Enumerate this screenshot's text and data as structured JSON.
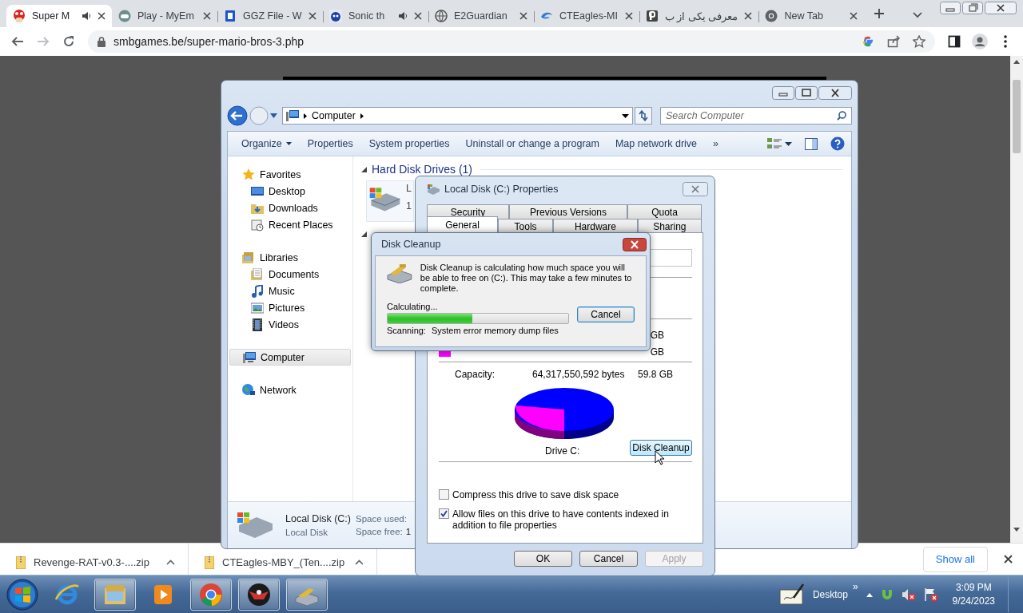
{
  "browser": {
    "tabs": [
      {
        "title": "Super M",
        "selected": true,
        "audio": true
      },
      {
        "title": "Play - MyEm",
        "selected": false,
        "audio": false
      },
      {
        "title": "GGZ File - W",
        "selected": false,
        "audio": false
      },
      {
        "title": "Sonic th",
        "selected": false,
        "audio": true
      },
      {
        "title": "E2Guardian",
        "selected": false,
        "audio": false
      },
      {
        "title": "CTEagles-MI",
        "selected": false,
        "audio": false
      },
      {
        "title": "معرفی یکی از ب",
        "selected": false,
        "audio": false
      },
      {
        "title": "New Tab",
        "selected": false,
        "audio": false
      }
    ],
    "address": "smbgames.be/super-mario-bros-3.php"
  },
  "explorer": {
    "address": "Computer",
    "search": {
      "placeholder": "Search Computer"
    },
    "toolbar": [
      {
        "label": "Organize",
        "menu": true
      },
      {
        "label": "Properties",
        "menu": false
      },
      {
        "label": "System properties",
        "menu": false
      },
      {
        "label": "Uninstall or change a program",
        "menu": false
      },
      {
        "label": "Map network drive",
        "menu": false
      }
    ],
    "overflow": "»",
    "nav": [
      {
        "label": "Favorites",
        "selected": false,
        "children": [
          {
            "label": "Desktop",
            "selected": false
          },
          {
            "label": "Downloads",
            "selected": false
          },
          {
            "label": "Recent Places",
            "selected": false
          }
        ]
      },
      {
        "label": "Libraries",
        "selected": false,
        "children": [
          {
            "label": "Documents",
            "selected": false
          },
          {
            "label": "Music",
            "selected": false
          },
          {
            "label": "Pictures",
            "selected": false
          },
          {
            "label": "Videos",
            "selected": false
          }
        ]
      },
      {
        "label": "Computer",
        "selected": true
      },
      {
        "label": "Network",
        "selected": false
      }
    ],
    "group": "Hard Disk Drives (1)",
    "drive": {
      "name": "L",
      "detail": "1"
    },
    "details": {
      "title": "Local Disk (C:)",
      "subtitle": "Local Disk",
      "fields": [
        {
          "label": "Space used:"
        },
        {
          "label": "Space free:",
          "value": "1"
        }
      ]
    }
  },
  "properties": {
    "title": "Local Disk (C:) Properties",
    "tab_rows": [
      [
        {
          "label": "Security",
          "selected": false
        },
        {
          "label": "Previous Versions",
          "selected": false
        },
        {
          "label": "Quota",
          "selected": false
        }
      ],
      [
        {
          "label": "General",
          "selected": true
        },
        {
          "label": "Tools",
          "selected": false
        },
        {
          "label": "Hardware",
          "selected": false
        },
        {
          "label": "Sharing",
          "selected": false
        }
      ]
    ],
    "space_rows": [
      {
        "size": "GB"
      },
      {
        "size": "GB",
        "color": "#ff00ff"
      }
    ],
    "capacity": {
      "label": "Capacity:",
      "bytes": "64,317,550,592 bytes",
      "size": "59.8 GB"
    },
    "drive_label": "Drive C:",
    "cleanup_button": "Disk Cleanup",
    "options": [
      {
        "label": "Compress this drive to save disk space",
        "checked": false
      },
      {
        "label": "Allow files on this drive to have contents indexed in addition to file properties",
        "checked": true
      }
    ],
    "buttons": [
      {
        "label": "OK",
        "disabled": false
      },
      {
        "label": "Cancel",
        "disabled": false
      },
      {
        "label": "Apply",
        "disabled": true
      }
    ]
  },
  "cleanup": {
    "title": "Disk Cleanup",
    "message": "Disk Cleanup is calculating how much space you will be able to free on  (C:). This may take a few minutes to complete.",
    "status": "Calculating...",
    "progress": {
      "level": 0.47
    },
    "cancel": "Cancel",
    "scanning_label": "Scanning:",
    "scanning_item": "System error memory dump files"
  },
  "downloads": {
    "items": [
      {
        "name": "Revenge-RAT-v0.3-....zip"
      },
      {
        "name": "CTEagles-MBY_(Ten....zip"
      }
    ],
    "show_all": "Show all"
  },
  "taskbar": {
    "apps": [
      {
        "running": false
      },
      {
        "running": true
      },
      {
        "running": false
      },
      {
        "running": true
      },
      {
        "running": true
      },
      {
        "running": true
      }
    ],
    "toolbar": "Desktop",
    "expand": "»",
    "time": "3:09 PM",
    "date": "9/24/2023"
  }
}
